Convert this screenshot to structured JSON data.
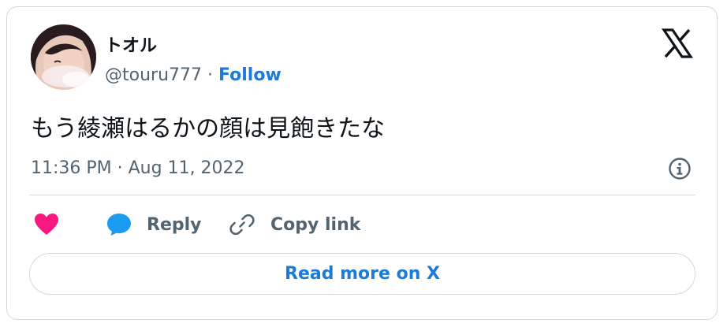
{
  "author": {
    "name": "トオル",
    "handle": "@touru777",
    "separator": " · ",
    "follow_label": "Follow"
  },
  "tweet": {
    "text": "もう綾瀬はるかの顔は見飽きたな",
    "timestamp": "11:36 PM · Aug 11, 2022"
  },
  "actions": {
    "reply_label": "Reply",
    "copy_link_label": "Copy link",
    "read_more_label": "Read more on X"
  },
  "icons": {
    "logo": "x-logo-icon",
    "info": "info-icon",
    "like": "heart-icon",
    "reply": "speech-bubble-icon",
    "copy": "link-icon"
  },
  "colors": {
    "accent": "#1d7bd8",
    "like": "#f91880",
    "reply": "#1d9bf0",
    "secondary_text": "#536471",
    "border": "#cfd9de"
  }
}
